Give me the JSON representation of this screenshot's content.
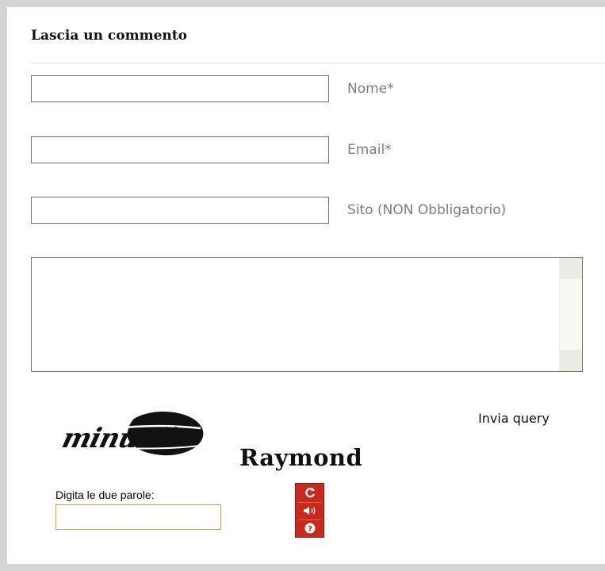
{
  "comment_form": {
    "title": "Lascia un commento",
    "name_label": "Nome*",
    "email_label": "Email*",
    "site_label": "Sito (NON Obbligatorio)",
    "name_value": "",
    "email_value": "",
    "site_value": "",
    "comment_value": "",
    "submit_label": "Invia query"
  },
  "captcha": {
    "word_1": "minuniic",
    "word_2": "Raymond",
    "prompt": "Digita le due parole:",
    "input_value": "",
    "tools": {
      "refresh_icon": "refresh-icon",
      "audio_icon": "speaker-icon",
      "help_icon": "help-icon"
    },
    "tool_color": "#c8291d"
  }
}
